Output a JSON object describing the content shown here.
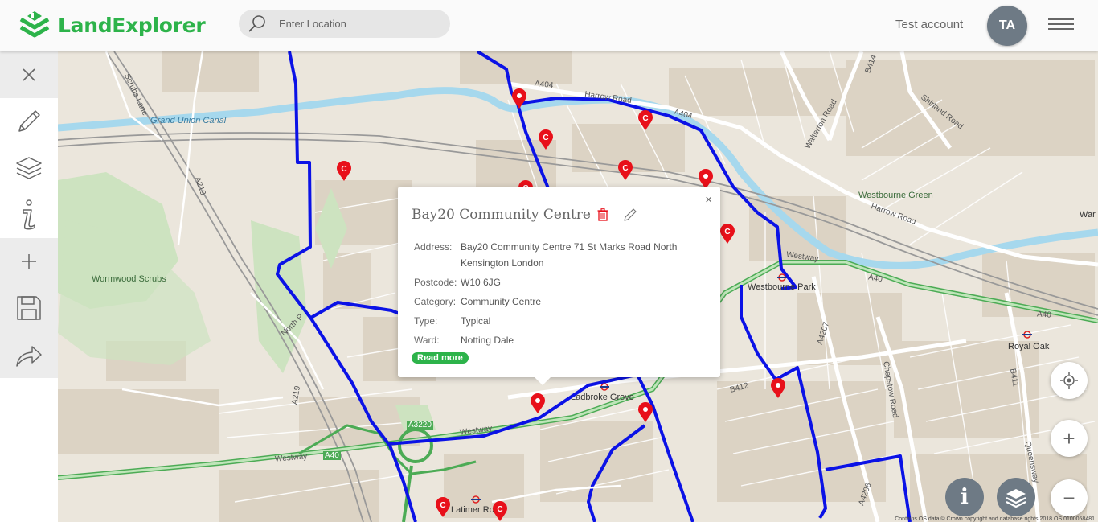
{
  "header": {
    "app_name": "LandExplorer",
    "search_placeholder": "Enter Location",
    "account_name": "Test account",
    "avatar_initials": "TA"
  },
  "sidebar": {
    "items": [
      {
        "name": "close",
        "icon": "close-icon"
      },
      {
        "name": "draw",
        "icon": "pencil-icon"
      },
      {
        "name": "layers",
        "icon": "layers-icon"
      },
      {
        "name": "info",
        "icon": "info-icon"
      },
      {
        "name": "add",
        "icon": "plus-icon"
      },
      {
        "name": "save",
        "icon": "save-icon"
      },
      {
        "name": "share",
        "icon": "share-icon"
      }
    ]
  },
  "map": {
    "labels": {
      "grand_union_canal": "Grand Union Canal",
      "scrubs_lane": "Scrubs Lane",
      "a219_north": "A219",
      "a219_south": "A219",
      "wormwood_scrubs": "Wormwood Scrubs",
      "north_pole_rd": "North P",
      "a404": "A404",
      "harrow_road": "Harrow Road",
      "a404_east": "A404",
      "walterton_road": "Walterton Road",
      "shirland_road": "Shirland Road",
      "b414": "B414",
      "westbourne_green": "Westbourne Green",
      "harrow_road_east": "Harrow Road",
      "war": "War",
      "westway_east": "Westway",
      "a40_east": "A40",
      "westbourne_park": "Westbourne Park",
      "a40_far": "A40",
      "a4207": "A4207",
      "royal_oak": "Royal Oak",
      "chepstow_road": "Chepstow Road",
      "b411": "B411",
      "queensway": "Queensway",
      "b412": "B412",
      "ladbroke_grove": "Ladbroke Grove",
      "a3220": "A3220",
      "westway_mid": "Westway",
      "westway_west": "Westway",
      "a40_west": "A40",
      "latimer_rd": "Latimer Ro",
      "a4206": "A4206"
    },
    "attribution": "Contains OS data © Crown copyright and database rights 2018 OS 0100058481"
  },
  "popup": {
    "title": "Bay20 Community Centre",
    "rows": [
      {
        "label": "Address:",
        "value": "Bay20 Community Centre 71 St Marks Road North Kensington London"
      },
      {
        "label": "Postcode:",
        "value": "W10 6JG"
      },
      {
        "label": "Category:",
        "value": "Community Centre"
      },
      {
        "label": "Type:",
        "value": "Typical"
      },
      {
        "label": "Ward:",
        "value": "Notting Dale"
      }
    ],
    "read_more": "Read more",
    "close": "×"
  },
  "controls": {
    "locate": "locate-icon",
    "zoom_in": "+",
    "zoom_out": "−",
    "info": "i",
    "layers": "layers-icon"
  },
  "colors": {
    "brand": "#2db34a",
    "boundary": "#0b12e6",
    "marker": "#e8101a",
    "avatar": "#6e7a85"
  }
}
